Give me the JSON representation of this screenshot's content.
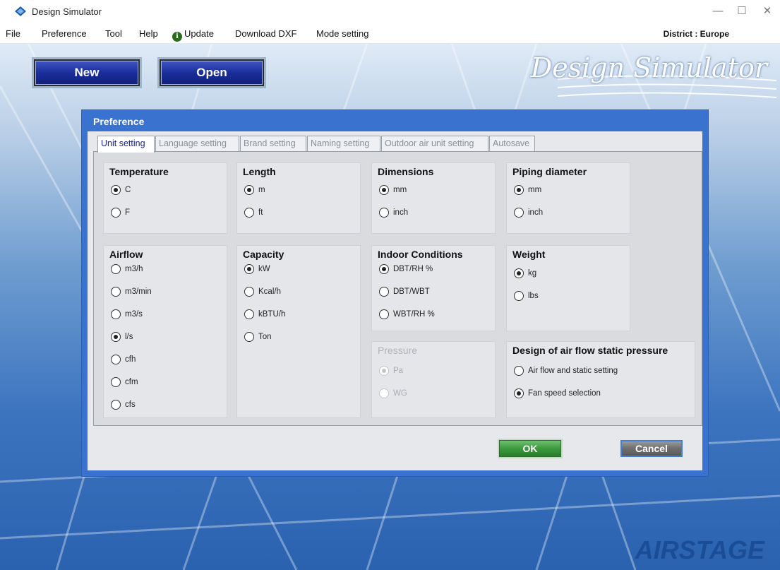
{
  "window": {
    "title": "Design Simulator",
    "controls": {
      "minimize": "—",
      "maximize": "☐",
      "close": "✕"
    }
  },
  "menu": {
    "items": [
      "File",
      "Preference",
      "Tool",
      "Help"
    ],
    "update": "Update",
    "update_icon": "info-icon",
    "download_dxf": "Download DXF",
    "mode_setting": "Mode setting",
    "district": "District : Europe"
  },
  "toolbar": {
    "new_label": "New",
    "open_label": "Open"
  },
  "logos": {
    "brand": "Design Simulator",
    "airstage": "AIRSTAGE"
  },
  "dialog": {
    "title": "Preference",
    "tabs": [
      {
        "label": "Unit setting",
        "active": true
      },
      {
        "label": "Language setting",
        "active": false
      },
      {
        "label": "Brand setting",
        "active": false
      },
      {
        "label": "Naming setting",
        "active": false
      },
      {
        "label": "Outdoor air unit setting",
        "active": false
      },
      {
        "label": "Autosave",
        "active": false
      }
    ],
    "groups": {
      "temperature": {
        "title": "Temperature",
        "options": [
          "C",
          "F"
        ],
        "selected": "C"
      },
      "length": {
        "title": "Length",
        "options": [
          "m",
          "ft"
        ],
        "selected": "m"
      },
      "dimensions": {
        "title": "Dimensions",
        "options": [
          "mm",
          "inch"
        ],
        "selected": "mm"
      },
      "piping": {
        "title": "Piping diameter",
        "options": [
          "mm",
          "inch"
        ],
        "selected": "mm"
      },
      "airflow": {
        "title": "Airflow",
        "options": [
          "m3/h",
          "m3/min",
          "m3/s",
          "l/s",
          "cfh",
          "cfm",
          "cfs"
        ],
        "selected": "l/s"
      },
      "capacity": {
        "title": "Capacity",
        "options": [
          "kW",
          "Kcal/h",
          "kBTU/h",
          "Ton"
        ],
        "selected": "kW"
      },
      "indoor": {
        "title": "Indoor Conditions",
        "options": [
          "DBT/RH %",
          "DBT/WBT",
          "WBT/RH %"
        ],
        "selected": "DBT/RH %"
      },
      "weight": {
        "title": "Weight",
        "options": [
          "kg",
          "lbs"
        ],
        "selected": "kg"
      },
      "pressure": {
        "title": "Pressure",
        "options": [
          "Pa",
          "WG"
        ],
        "selected": "Pa",
        "disabled": true
      },
      "static": {
        "title": "Design of air flow static pressure",
        "options": [
          "Air flow and static setting",
          "Fan speed selection"
        ],
        "selected": "Fan speed selection"
      }
    },
    "ok_label": "OK",
    "cancel_label": "Cancel"
  },
  "colors": {
    "dialog_blue": "#3a72d0",
    "ok_green": "#3d9a3d",
    "button_navy": "#1b2f9c"
  }
}
